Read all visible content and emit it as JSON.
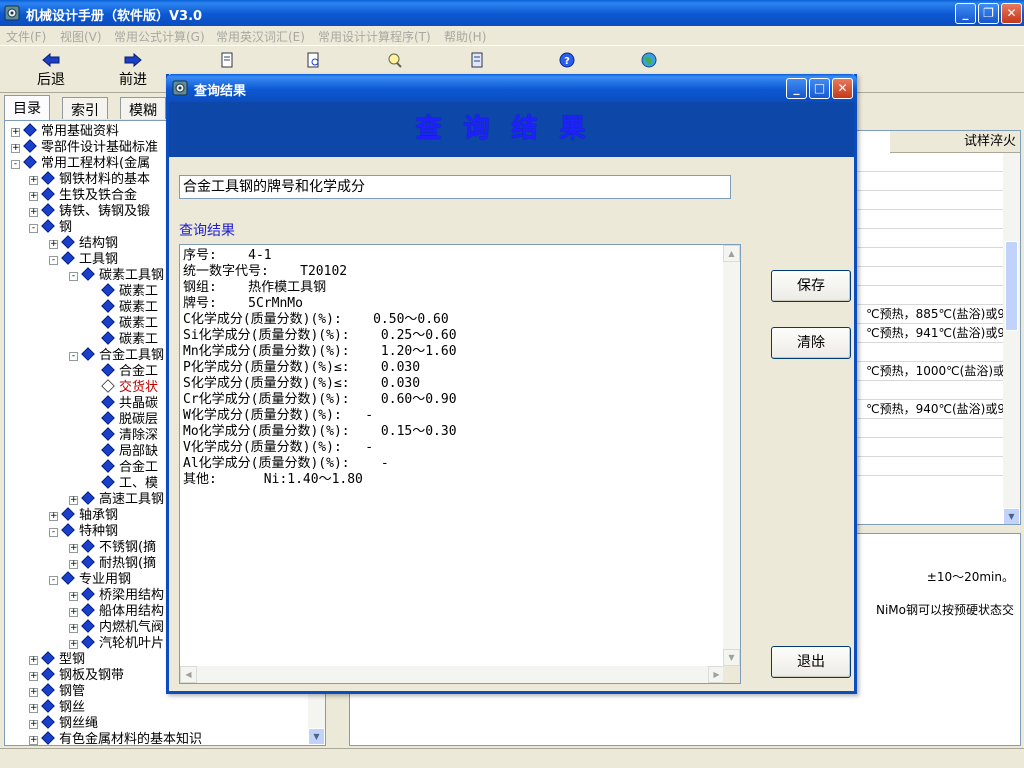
{
  "app": {
    "title": "机械设计手册（软件版）V3.0",
    "window_buttons": {
      "minimize": "_",
      "restore": "❐",
      "close": "✕"
    }
  },
  "menu": [
    "文件(F)",
    "视图(V)",
    "常用公式计算(G)",
    "常用英汉词汇(E)",
    "常用设计计算程序(T)",
    "帮助(H)"
  ],
  "toolbar": {
    "back": "后退",
    "forward": "前进"
  },
  "left_tabs": [
    "目录",
    "索引",
    "模糊"
  ],
  "tree": [
    {
      "level": 0,
      "pm": "+",
      "label": "常用基础资料",
      "open": false
    },
    {
      "level": 0,
      "pm": "+",
      "label": "零部件设计基础标准",
      "open": false
    },
    {
      "level": 0,
      "pm": "-",
      "label": "常用工程材料(金属",
      "open": false
    },
    {
      "level": 1,
      "pm": "+",
      "label": "钢铁材料的基本",
      "open": false
    },
    {
      "level": 1,
      "pm": "+",
      "label": "生铁及铁合金",
      "open": false
    },
    {
      "level": 1,
      "pm": "+",
      "label": "铸铁、铸钢及锻",
      "open": false
    },
    {
      "level": 1,
      "pm": "-",
      "label": "钢",
      "open": false
    },
    {
      "level": 2,
      "pm": "+",
      "label": "结构钢",
      "open": false
    },
    {
      "level": 2,
      "pm": "-",
      "label": "工具钢",
      "open": false
    },
    {
      "level": 3,
      "pm": "-",
      "label": "碳素工具钢",
      "open": false
    },
    {
      "level": 4,
      "pm": "",
      "label": "碳素工",
      "open": false
    },
    {
      "level": 4,
      "pm": "",
      "label": "碳素工",
      "open": false
    },
    {
      "level": 4,
      "pm": "",
      "label": "碳素工",
      "open": false
    },
    {
      "level": 4,
      "pm": "",
      "label": "碳素工",
      "open": false
    },
    {
      "level": 3,
      "pm": "-",
      "label": "合金工具钢",
      "open": false
    },
    {
      "level": 4,
      "pm": "",
      "label": "合金工",
      "open": false
    },
    {
      "level": 4,
      "pm": "",
      "label": "交货状",
      "open": true,
      "red": true
    },
    {
      "level": 4,
      "pm": "",
      "label": "共晶碳",
      "open": false
    },
    {
      "level": 4,
      "pm": "",
      "label": "脱碳层",
      "open": false
    },
    {
      "level": 4,
      "pm": "",
      "label": "清除深",
      "open": false
    },
    {
      "level": 4,
      "pm": "",
      "label": "局部缺",
      "open": false
    },
    {
      "level": 4,
      "pm": "",
      "label": "合金工",
      "open": false
    },
    {
      "level": 4,
      "pm": "",
      "label": "工、模",
      "open": false
    },
    {
      "level": 3,
      "pm": "+",
      "label": "高速工具钢",
      "open": false
    },
    {
      "level": 2,
      "pm": "+",
      "label": "轴承钢",
      "open": false
    },
    {
      "level": 2,
      "pm": "-",
      "label": "特种钢",
      "open": false
    },
    {
      "level": 3,
      "pm": "+",
      "label": "不锈钢(摘",
      "open": false
    },
    {
      "level": 3,
      "pm": "+",
      "label": "耐热钢(摘",
      "open": false
    },
    {
      "level": 2,
      "pm": "-",
      "label": "专业用钢",
      "open": false
    },
    {
      "level": 3,
      "pm": "+",
      "label": "桥梁用结构",
      "open": false
    },
    {
      "level": 3,
      "pm": "+",
      "label": "船体用结构",
      "open": false
    },
    {
      "level": 3,
      "pm": "+",
      "label": "内燃机气阀",
      "open": false
    },
    {
      "level": 3,
      "pm": "+",
      "label": "汽轮机叶片",
      "open": false
    },
    {
      "level": 1,
      "pm": "+",
      "label": "型钢",
      "open": false
    },
    {
      "level": 1,
      "pm": "+",
      "label": "钢板及钢带",
      "open": false
    },
    {
      "level": 1,
      "pm": "+",
      "label": "钢管",
      "open": false
    },
    {
      "level": 1,
      "pm": "+",
      "label": "钢丝",
      "open": false
    },
    {
      "level": 1,
      "pm": "+",
      "label": "钢丝绳",
      "open": false
    },
    {
      "level": 1,
      "pm": "+",
      "label": "有色金属材料的基本知识",
      "open": false
    }
  ],
  "right_table": {
    "header": "试样淬火",
    "rows": [
      "",
      "",
      "",
      "",
      "",
      "",
      "",
      "",
      "℃预热，885℃(盐浴)或9",
      "℃预热，941℃(盐浴)或9",
      "",
      "℃预热，1000℃(盐浴)或",
      "",
      "℃预热，940℃(盐浴)或9",
      "",
      "",
      ""
    ]
  },
  "right_bottom": [
    "±10～20min。",
    "NiMo钢可以按预硬状态交"
  ],
  "dialog": {
    "title": "查询结果",
    "banner": "查询结果",
    "query": "合金工具钢的牌号和化学成分",
    "result_label": "查询结果",
    "result_lines": [
      "序号:    4-1",
      "统一数字代号:    T20102",
      "钢组:    热作模工具钢",
      "牌号:    5CrMnMo",
      "C化学成分(质量分数)(%):    0.50～0.60",
      "Si化学成分(质量分数)(%):    0.25～0.60",
      "Mn化学成分(质量分数)(%):    1.20～1.60",
      "P化学成分(质量分数)(%)≤:    0.030",
      "S化学成分(质量分数)(%)≤:    0.030",
      "Cr化学成分(质量分数)(%):    0.60～0.90",
      "W化学成分(质量分数)(%):   -",
      "Mo化学成分(质量分数)(%):    0.15～0.30",
      "V化学成分(质量分数)(%):   -",
      "Al化学成分(质量分数)(%):    -",
      "其他:      Ni:1.40～1.80"
    ],
    "buttons": {
      "save": "保存",
      "clear": "清除",
      "exit": "退出"
    }
  }
}
